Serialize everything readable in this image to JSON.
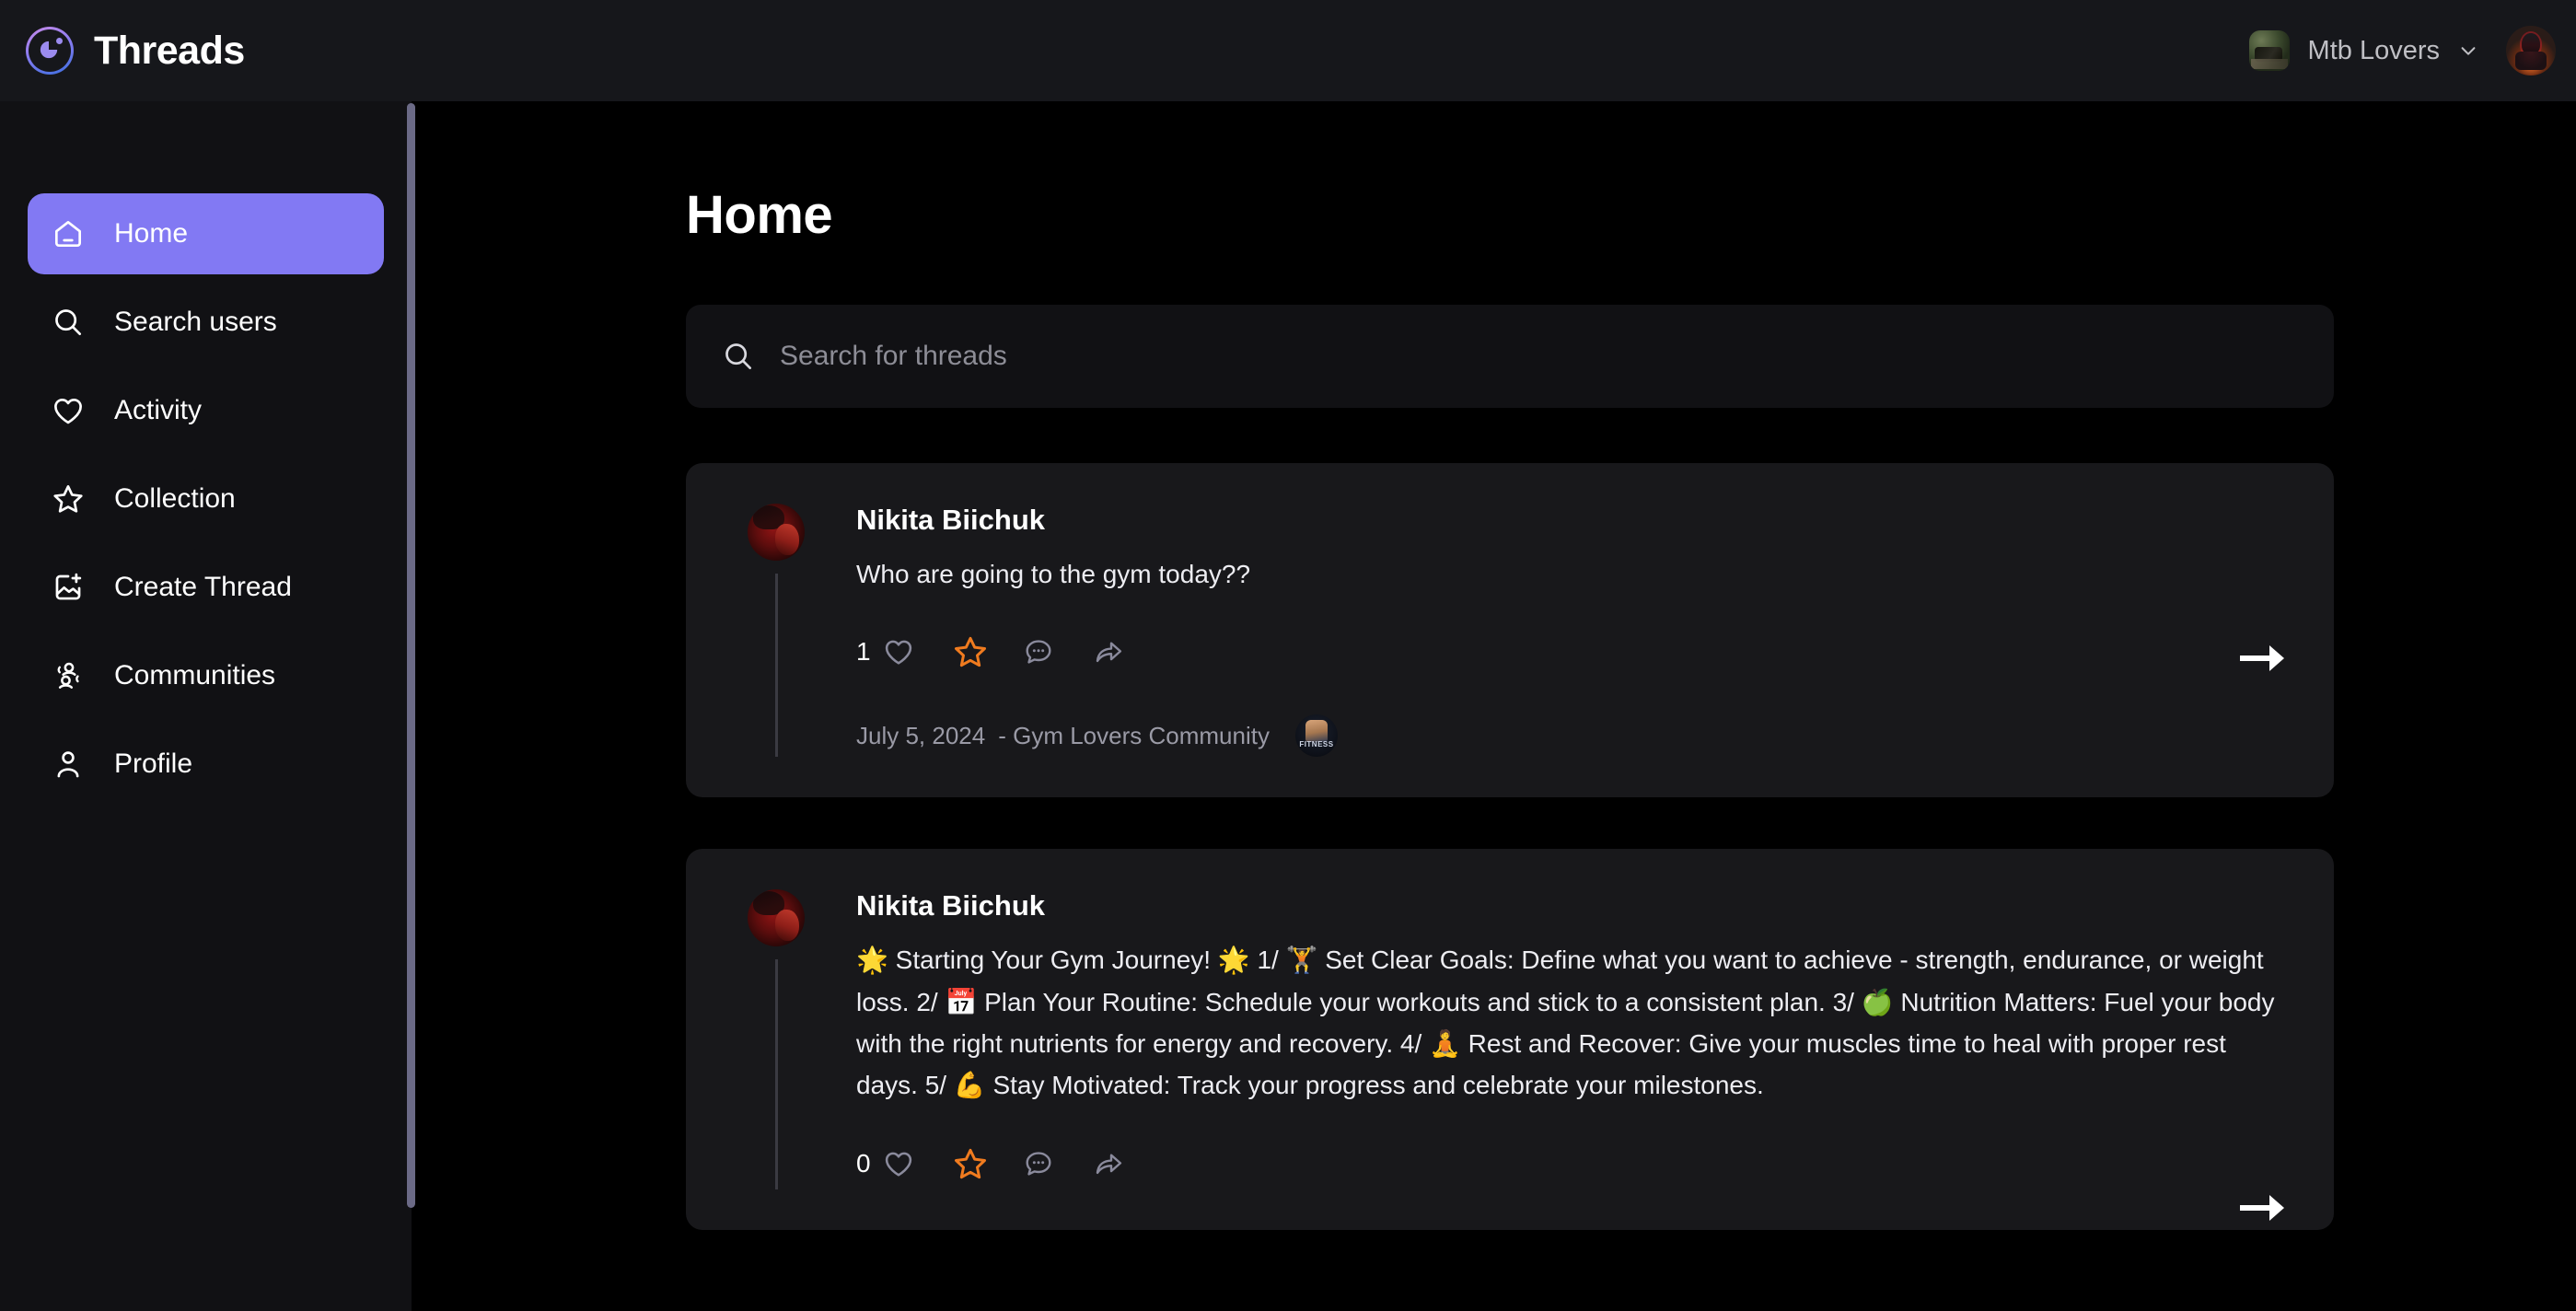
{
  "app": {
    "brand_title": "Threads",
    "logo_icon": "threads-logo-icon"
  },
  "topbar": {
    "community_switcher": {
      "label": "Mtb Lovers",
      "thumb_alt": "mountain-bike-thumbnail",
      "chevron_icon": "chevron-down-icon"
    },
    "user_avatar_alt": "user-profile-avatar"
  },
  "sidebar": {
    "items": [
      {
        "label": "Home",
        "icon": "home-icon",
        "active": true
      },
      {
        "label": "Search users",
        "icon": "search-icon",
        "active": false
      },
      {
        "label": "Activity",
        "icon": "heart-icon",
        "active": false
      },
      {
        "label": "Collection",
        "icon": "star-icon",
        "active": false
      },
      {
        "label": "Create Thread",
        "icon": "image-plus-icon",
        "active": false
      },
      {
        "label": "Communities",
        "icon": "users-group-icon",
        "active": false
      },
      {
        "label": "Profile",
        "icon": "person-icon",
        "active": false
      }
    ]
  },
  "main": {
    "page_title": "Home",
    "search": {
      "placeholder": "Search for threads",
      "value": "",
      "icon": "search-icon"
    },
    "threads": [
      {
        "author": "Nikita Biichuk",
        "avatar_alt": "nikita-biichuk-avatar",
        "text": "Who are going to the gym today??",
        "like_count": "1",
        "actions": {
          "like": "heart-icon",
          "save": "star-icon",
          "comment": "comment-bubble-icon",
          "share": "share-arrow-icon"
        },
        "date": "July 5, 2024",
        "community": "- Gym Lovers Community",
        "community_badge_alt": "fitness-community-logo",
        "community_badge_text": "FITNESS",
        "goto_icon": "arrow-right-icon"
      },
      {
        "author": "Nikita Biichuk",
        "avatar_alt": "nikita-biichuk-avatar",
        "text": "🌟 Starting Your Gym Journey! 🌟 1/ 🏋️ Set Clear Goals: Define what you want to achieve - strength, endurance, or weight loss. 2/ 📅 Plan Your Routine: Schedule your workouts and stick to a consistent plan. 3/ 🍏 Nutrition Matters: Fuel your body with the right nutrients for energy and recovery. 4/ 🧘 Rest and Recover: Give your muscles time to heal with proper rest days. 5/ 💪 Stay Motivated: Track your progress and celebrate your milestones.",
        "like_count": "0",
        "actions": {
          "like": "heart-icon",
          "save": "star-icon",
          "comment": "comment-bubble-icon",
          "share": "share-arrow-icon"
        },
        "goto_icon": "arrow-right-icon"
      }
    ]
  },
  "colors": {
    "accent_purple": "#8279F3",
    "star_orange": "#F07B1F",
    "page_bg": "#000000",
    "sidebar_bg": "#111114",
    "card_bg": "#18181B",
    "topbar_bg": "#16171B",
    "muted_text": "#9A9AA6",
    "icon_muted": "#8A8A9C",
    "scrollbar": "#6B6A86"
  }
}
